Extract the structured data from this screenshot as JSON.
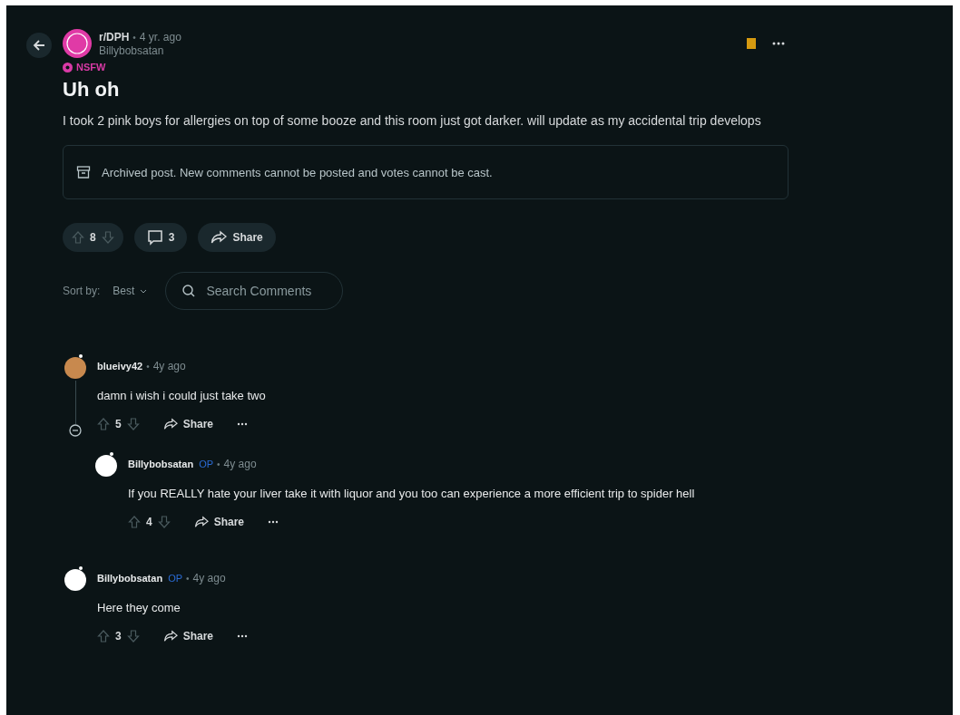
{
  "post": {
    "subreddit": "r/DPH",
    "separator": "•",
    "time": "4 yr. ago",
    "author": "Billybobsatan",
    "nsfw_label": "NSFW",
    "title": "Uh oh",
    "body": "I took 2 pink boys for allergies on top of some booze and this room just got darker. will update as my accidental trip develops",
    "archived_notice": "Archived post. New comments cannot be posted and votes cannot be cast.",
    "votes": "8",
    "comments": "3",
    "share": "Share"
  },
  "sort": {
    "label": "Sort by:",
    "value": "Best"
  },
  "search": {
    "placeholder": "Search Comments"
  },
  "comments": [
    {
      "author": "blueivy42",
      "op": false,
      "separator": "•",
      "time": "4y ago",
      "text": "damn i wish i could just take two",
      "votes": "5",
      "share": "Share",
      "color": "#c8894e",
      "expanded": true,
      "children": [
        {
          "author": "Billybobsatan",
          "op": true,
          "op_label": "OP",
          "separator": "•",
          "time": "4y ago",
          "text": "If you REALLY hate your liver take it with liquor and you too can experience a more efficient trip to spider hell",
          "votes": "4",
          "share": "Share",
          "color": "#ffffff"
        }
      ]
    },
    {
      "author": "Billybobsatan",
      "op": true,
      "op_label": "OP",
      "separator": "•",
      "time": "4y ago",
      "text": "Here they come",
      "votes": "3",
      "share": "Share",
      "color": "#ffffff"
    }
  ]
}
